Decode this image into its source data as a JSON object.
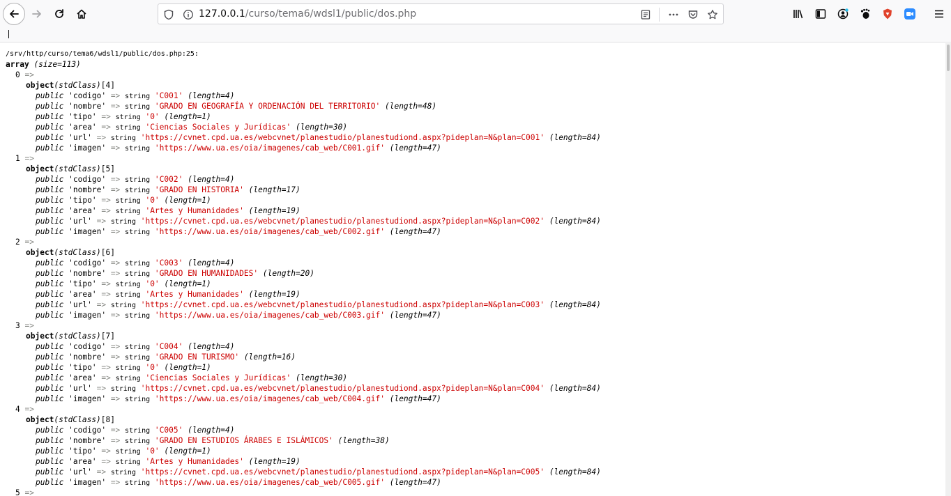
{
  "browser": {
    "url_prefix": "127.0.0.1",
    "url_path": "/curso/tema6/wdsl1/public/dos.php"
  },
  "dump": {
    "path": "/srv/http/curso/tema6/wdsl1/public/dos.php:25:",
    "array_label": "array",
    "size_label": "(size=113)",
    "items": [
      {
        "index": "0",
        "object_id": "[4]",
        "props": [
          {
            "key": "'codigo'",
            "value": "'C001'",
            "len": "(length=4)"
          },
          {
            "key": "'nombre'",
            "value": "'GRADO EN GEOGRAFÍA Y ORDENACIÓN DEL TERRITORIO'",
            "len": "(length=48)"
          },
          {
            "key": "'tipo'",
            "value": "'0'",
            "len": "(length=1)"
          },
          {
            "key": "'area'",
            "value": "'Ciencias Sociales y Jurídicas'",
            "len": "(length=30)"
          },
          {
            "key": "'url'",
            "value": "'https://cvnet.cpd.ua.es/webcvnet/planestudio/planestudiond.aspx?pideplan=N&plan=C001'",
            "len": "(length=84)"
          },
          {
            "key": "'imagen'",
            "value": "'https://www.ua.es/oia/imagenes/cab_web/C001.gif'",
            "len": "(length=47)"
          }
        ]
      },
      {
        "index": "1",
        "object_id": "[5]",
        "props": [
          {
            "key": "'codigo'",
            "value": "'C002'",
            "len": "(length=4)"
          },
          {
            "key": "'nombre'",
            "value": "'GRADO EN HISTORIA'",
            "len": "(length=17)"
          },
          {
            "key": "'tipo'",
            "value": "'0'",
            "len": "(length=1)"
          },
          {
            "key": "'area'",
            "value": "'Artes y Humanidades'",
            "len": "(length=19)"
          },
          {
            "key": "'url'",
            "value": "'https://cvnet.cpd.ua.es/webcvnet/planestudio/planestudiond.aspx?pideplan=N&plan=C002'",
            "len": "(length=84)"
          },
          {
            "key": "'imagen'",
            "value": "'https://www.ua.es/oia/imagenes/cab_web/C002.gif'",
            "len": "(length=47)"
          }
        ]
      },
      {
        "index": "2",
        "object_id": "[6]",
        "props": [
          {
            "key": "'codigo'",
            "value": "'C003'",
            "len": "(length=4)"
          },
          {
            "key": "'nombre'",
            "value": "'GRADO EN HUMANIDADES'",
            "len": "(length=20)"
          },
          {
            "key": "'tipo'",
            "value": "'0'",
            "len": "(length=1)"
          },
          {
            "key": "'area'",
            "value": "'Artes y Humanidades'",
            "len": "(length=19)"
          },
          {
            "key": "'url'",
            "value": "'https://cvnet.cpd.ua.es/webcvnet/planestudio/planestudiond.aspx?pideplan=N&plan=C003'",
            "len": "(length=84)"
          },
          {
            "key": "'imagen'",
            "value": "'https://www.ua.es/oia/imagenes/cab_web/C003.gif'",
            "len": "(length=47)"
          }
        ]
      },
      {
        "index": "3",
        "object_id": "[7]",
        "props": [
          {
            "key": "'codigo'",
            "value": "'C004'",
            "len": "(length=4)"
          },
          {
            "key": "'nombre'",
            "value": "'GRADO EN TURISMO'",
            "len": "(length=16)"
          },
          {
            "key": "'tipo'",
            "value": "'0'",
            "len": "(length=1)"
          },
          {
            "key": "'area'",
            "value": "'Ciencias Sociales y Jurídicas'",
            "len": "(length=30)"
          },
          {
            "key": "'url'",
            "value": "'https://cvnet.cpd.ua.es/webcvnet/planestudio/planestudiond.aspx?pideplan=N&plan=C004'",
            "len": "(length=84)"
          },
          {
            "key": "'imagen'",
            "value": "'https://www.ua.es/oia/imagenes/cab_web/C004.gif'",
            "len": "(length=47)"
          }
        ]
      },
      {
        "index": "4",
        "object_id": "[8]",
        "props": [
          {
            "key": "'codigo'",
            "value": "'C005'",
            "len": "(length=4)"
          },
          {
            "key": "'nombre'",
            "value": "'GRADO EN ESTUDIOS ÁRABES E ISLÁMICOS'",
            "len": "(length=38)"
          },
          {
            "key": "'tipo'",
            "value": "'0'",
            "len": "(length=1)"
          },
          {
            "key": "'area'",
            "value": "'Artes y Humanidades'",
            "len": "(length=19)"
          },
          {
            "key": "'url'",
            "value": "'https://cvnet.cpd.ua.es/webcvnet/planestudio/planestudiond.aspx?pideplan=N&plan=C005'",
            "len": "(length=84)"
          },
          {
            "key": "'imagen'",
            "value": "'https://www.ua.es/oia/imagenes/cab_web/C005.gif'",
            "len": "(length=47)"
          }
        ]
      }
    ],
    "next_index": "5",
    "arrow": "=>",
    "object_label": "object",
    "class_name": "(stdClass)",
    "public_label": "public",
    "string_label": "string"
  }
}
